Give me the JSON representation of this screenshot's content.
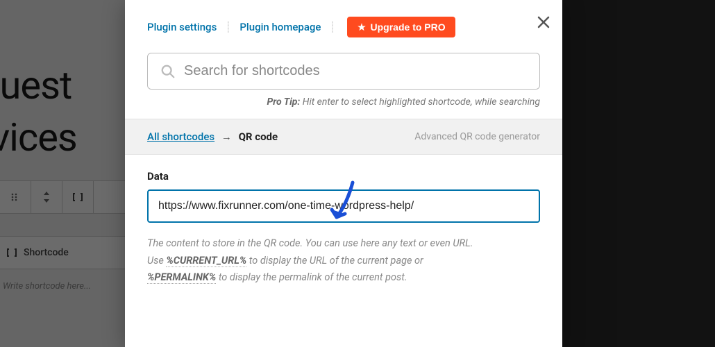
{
  "background": {
    "title_line1": "equest",
    "title_line2": "ervices",
    "shortcode_label": "Shortcode",
    "write_placeholder": "Write shortcode here..."
  },
  "modal": {
    "header": {
      "plugin_settings": "Plugin settings",
      "plugin_homepage": "Plugin homepage",
      "upgrade_label": "Upgrade to PRO"
    },
    "search": {
      "placeholder": "Search for shortcodes"
    },
    "pro_tip": {
      "label": "Pro Tip:",
      "text": "Hit enter to select highlighted shortcode, while searching"
    },
    "breadcrumb": {
      "all_shortcodes": "All shortcodes",
      "current": "QR code",
      "description": "Advanced QR code generator"
    },
    "form": {
      "data_label": "Data",
      "data_value": "https://www.fixrunner.com/one-time-wordpress-help/",
      "help_line1": "The content to store in the QR code. You can use here any text or even URL.",
      "help_line2a": "Use ",
      "help_token1": "%CURRENT_URL%",
      "help_line2b": " to display the URL of the current page or",
      "help_token2": "%PERMALINK%",
      "help_line3": " to display the permalink of the current post."
    }
  }
}
